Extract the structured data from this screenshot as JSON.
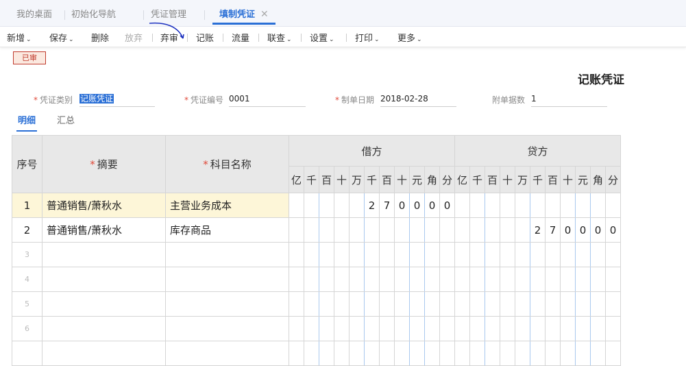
{
  "tabs": [
    {
      "label": "我的桌面"
    },
    {
      "label": "初始化导航"
    },
    {
      "label": "凭证管理"
    },
    {
      "label": "填制凭证",
      "close": "✕"
    }
  ],
  "toolbar": {
    "items": [
      {
        "label": "新增",
        "caret": "⌄"
      },
      {
        "label": "保存",
        "caret": "⌄"
      },
      {
        "label": "删除"
      },
      {
        "label": "放弃"
      },
      {
        "label": "弃审"
      },
      {
        "label": "记账"
      },
      {
        "label": "流量"
      },
      {
        "label": "联查",
        "caret": "⌄"
      },
      {
        "label": "设置",
        "caret": "⌄"
      },
      {
        "label": "打印",
        "caret": "⌄"
      },
      {
        "label": "更多",
        "caret": "⌄"
      }
    ]
  },
  "status_badge": "已审",
  "doc_title": "记账凭证",
  "fields": {
    "type": {
      "label": "凭证类别",
      "value": "记账凭证"
    },
    "number": {
      "label": "凭证编号",
      "value": "0001"
    },
    "date": {
      "label": "制单日期",
      "value": "2018-02-28"
    },
    "attachments": {
      "label": "附单据数",
      "value": "1"
    }
  },
  "subtabs": [
    {
      "label": "明细"
    },
    {
      "label": "汇总"
    }
  ],
  "grid": {
    "headers": {
      "seq": "序号",
      "summary": "摘要",
      "account": "科目名称",
      "debit": "借方",
      "credit": "贷方",
      "required_mark": "*"
    },
    "digit_units": [
      "亿",
      "千",
      "百",
      "十",
      "万",
      "千",
      "百",
      "十",
      "元",
      "角",
      "分"
    ],
    "rows": [
      {
        "seq": "1",
        "summary": "普通销售/萧秋水",
        "account": "主营业务成本",
        "debit": [
          "",
          "",
          "",
          "",
          "",
          "2",
          "7",
          "0",
          "0",
          "0",
          "0"
        ],
        "credit": [
          "",
          "",
          "",
          "",
          "",
          "",
          "",
          "",
          "",
          "",
          ""
        ]
      },
      {
        "seq": "2",
        "summary": "普通销售/萧秋水",
        "account": "库存商品",
        "debit": [
          "",
          "",
          "",
          "",
          "",
          "",
          "",
          "",
          "",
          "",
          ""
        ],
        "credit": [
          "",
          "",
          "",
          "",
          "",
          "2",
          "7",
          "0",
          "0",
          "0",
          "0"
        ]
      },
      {
        "seq": "3",
        "summary": "",
        "account": "",
        "debit": [],
        "credit": []
      },
      {
        "seq": "4",
        "summary": "",
        "account": "",
        "debit": [],
        "credit": []
      },
      {
        "seq": "5",
        "summary": "",
        "account": "",
        "debit": [],
        "credit": []
      },
      {
        "seq": "6",
        "summary": "",
        "account": "",
        "debit": [],
        "credit": []
      },
      {
        "seq": "",
        "summary": "",
        "account": "",
        "debit": [],
        "credit": []
      }
    ]
  }
}
